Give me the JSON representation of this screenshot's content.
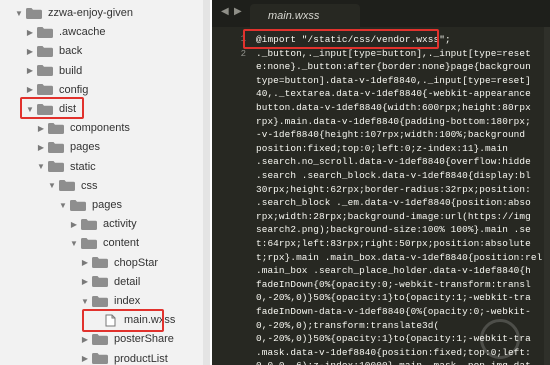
{
  "sidebar": {
    "items": [
      {
        "label": "zzwa-enjoy-given",
        "type": "folder",
        "expanded": true,
        "depth": 0,
        "arrow": "chevron-down"
      },
      {
        "label": ".awcache",
        "type": "folder",
        "expanded": false,
        "depth": 1,
        "arrow": "chevron-right"
      },
      {
        "label": "back",
        "type": "folder",
        "expanded": false,
        "depth": 1,
        "arrow": "chevron-right"
      },
      {
        "label": "build",
        "type": "folder",
        "expanded": false,
        "depth": 1,
        "arrow": "chevron-right"
      },
      {
        "label": "config",
        "type": "folder",
        "expanded": false,
        "depth": 1,
        "arrow": "chevron-right"
      },
      {
        "label": "dist",
        "type": "folder",
        "expanded": true,
        "depth": 1,
        "arrow": "chevron-down"
      },
      {
        "label": "components",
        "type": "folder",
        "expanded": false,
        "depth": 2,
        "arrow": "chevron-right"
      },
      {
        "label": "pages",
        "type": "folder",
        "expanded": false,
        "depth": 2,
        "arrow": "chevron-right"
      },
      {
        "label": "static",
        "type": "folder",
        "expanded": true,
        "depth": 2,
        "arrow": "chevron-down"
      },
      {
        "label": "css",
        "type": "folder",
        "expanded": true,
        "depth": 3,
        "arrow": "chevron-down"
      },
      {
        "label": "pages",
        "type": "folder",
        "expanded": true,
        "depth": 4,
        "arrow": "chevron-down"
      },
      {
        "label": "activity",
        "type": "folder",
        "expanded": false,
        "depth": 5,
        "arrow": "chevron-right"
      },
      {
        "label": "content",
        "type": "folder",
        "expanded": true,
        "depth": 5,
        "arrow": "chevron-down"
      },
      {
        "label": "chopStar",
        "type": "folder",
        "expanded": false,
        "depth": 6,
        "arrow": "chevron-right"
      },
      {
        "label": "detail",
        "type": "folder",
        "expanded": false,
        "depth": 6,
        "arrow": "chevron-right"
      },
      {
        "label": "index",
        "type": "folder",
        "expanded": true,
        "depth": 6,
        "arrow": "chevron-down"
      },
      {
        "label": "main.wxss",
        "type": "file",
        "expanded": false,
        "depth": 7,
        "arrow": ""
      },
      {
        "label": "posterShare",
        "type": "folder",
        "expanded": false,
        "depth": 6,
        "arrow": "chevron-right"
      },
      {
        "label": "productList",
        "type": "folder",
        "expanded": false,
        "depth": 6,
        "arrow": "chevron-right"
      }
    ]
  },
  "editor": {
    "tab_label": "main.wxss",
    "nav_back": "◀",
    "nav_forward": "▶",
    "line_numbers": [
      "1",
      "2"
    ],
    "lines": [
      "@import \"/static/css/vendor.wxss\";",
      "._button,._input[type=button],._input[type=reset",
      "e:none}._button:after{border:none}page{backgroun",
      "type=button].data-v-1def8840,._input[type=reset]",
      "40,._textarea.data-v-1def8840{-webkit-appearance",
      "button.data-v-1def8840{width:600rpx;height:80rpx",
      "rpx}.main.data-v-1def8840{padding-bottom:180rpx;",
      "-v-1def8840{height:107rpx;width:100%;background",
      "position:fixed;top:0;left:0;z-index:11}.main",
      ".search.no_scroll.data-v-1def8840{overflow:hidde",
      ".search .search_block.data-v-1def8840{display:bl",
      "30rpx;height:62rpx;border-radius:32rpx;position:",
      ".search_block ._em.data-v-1def8840{position:abso",
      "rpx;width:28rpx;background-image:url(https://img",
      "search2.png);background-size:100% 100%}.main .se",
      "t:64rpx;left:83rpx;right:50rpx;position:absolute",
      "t;rpx}.main .main_box.data-v-1def8840{position:rel",
      ".main_box .search_place_holder.data-v-1def8840{h",
      "fadeInDown{0%{opacity:0;-webkit-transform:transl",
      "0,-20%,0)}50%{opacity:1}to{opacity:1;-webkit-tra",
      "fadeInDown-data-v-1def8840{0%{opacity:0;-webkit-",
      "0,-20%,0);transform:translate3d(",
      "0,-20%,0)}50%{opacity:1}to{opacity:1;-webkit-tra",
      ".mask.data-v-1def8840{position:fixed;top:0;left:",
      "0,0,0,.6);z-index:10000}.main .mask .pop_img.dat"
    ]
  },
  "colors": {
    "sidebar_bg": "#f2f2f2",
    "folder": "#8e8e8e",
    "editor_bg": "#272822",
    "code_text": "#f8f8f2",
    "highlight_border": "#e1322d"
  }
}
